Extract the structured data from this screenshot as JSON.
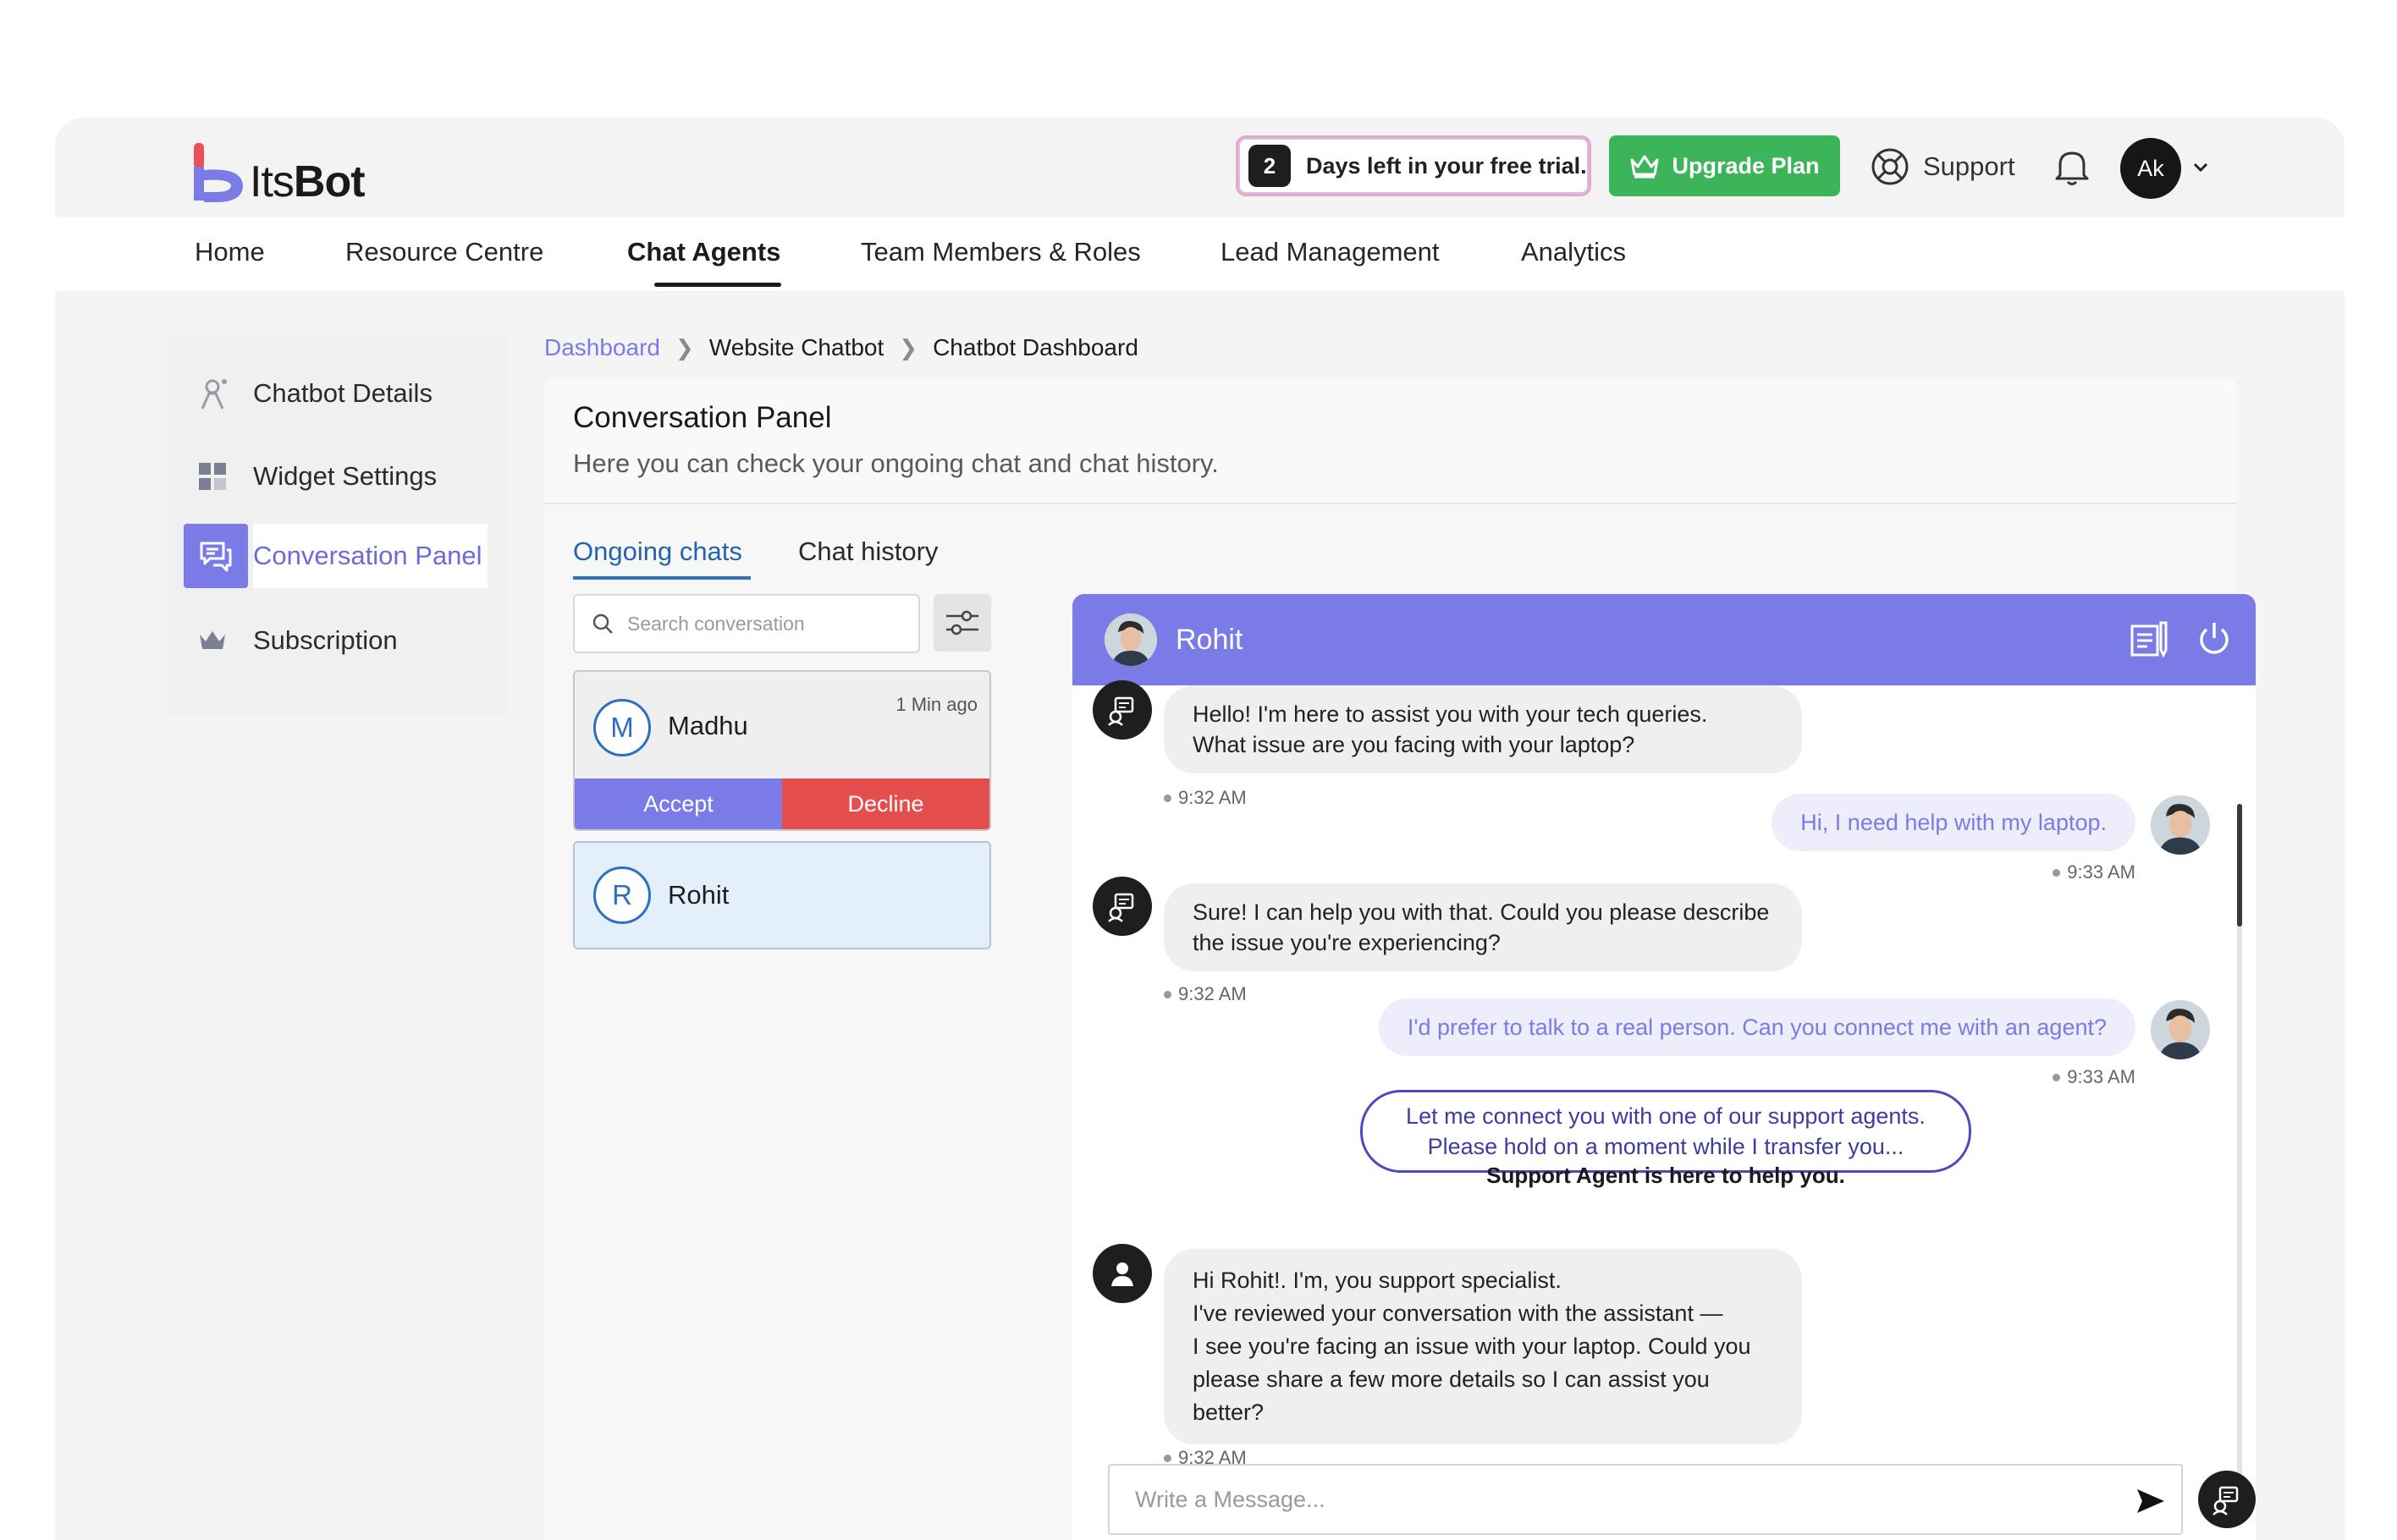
{
  "brand": {
    "logo_text_light": "Its",
    "logo_text_bold": "Bot",
    "accent": "#7b7be7"
  },
  "header": {
    "trial_days": "2",
    "trial_text": "Days left in your free trial.",
    "upgrade_label": "Upgrade Plan",
    "support_label": "Support",
    "avatar_initials": "Ak"
  },
  "nav": {
    "items": [
      {
        "label": "Home"
      },
      {
        "label": "Resource Centre"
      },
      {
        "label": "Chat Agents"
      },
      {
        "label": "Team Members & Roles"
      },
      {
        "label": "Lead Management"
      },
      {
        "label": "Analytics"
      }
    ],
    "active": "Chat Agents"
  },
  "sidebar": {
    "items": [
      {
        "label": "Chatbot Details",
        "icon": "chatbot-icon"
      },
      {
        "label": "Widget Settings",
        "icon": "widget-icon"
      },
      {
        "label": "Conversation Panel",
        "icon": "conversation-icon"
      },
      {
        "label": "Subscription",
        "icon": "crown-icon"
      }
    ],
    "active": "Conversation Panel"
  },
  "breadcrumb": {
    "items": [
      "Dashboard",
      "Website Chatbot",
      "Chatbot Dashboard"
    ]
  },
  "panel": {
    "title": "Conversation Panel",
    "subtitle": "Here you can check your ongoing chat and chat history."
  },
  "tabs": {
    "ongoing": "Ongoing chats",
    "history": "Chat history"
  },
  "search": {
    "placeholder": "Search conversation"
  },
  "conversations": [
    {
      "initial": "M",
      "name": "Madhu",
      "time": "1 Min ago",
      "accept": "Accept",
      "decline": "Decline"
    },
    {
      "initial": "R",
      "name": "Rohit"
    }
  ],
  "chat": {
    "contact_name": "Rohit",
    "messages": [
      {
        "from": "bot",
        "lines": [
          "Hello! I'm here to assist you with your tech queries.",
          "What issue are you facing with your laptop?"
        ],
        "time": "9:32 AM"
      },
      {
        "from": "user",
        "lines": [
          "Hi, I need help with my laptop."
        ],
        "time": "9:33 AM"
      },
      {
        "from": "bot",
        "lines": [
          "Sure! I can help you with that. Could you please describe",
          "the issue you're experiencing?"
        ],
        "time": "9:32 AM"
      },
      {
        "from": "user",
        "lines": [
          "I'd prefer to talk to a real person. Can you connect me with an agent?"
        ],
        "time": "9:33 AM"
      },
      {
        "from": "system",
        "lines": [
          "Let me connect you with one of our support agents.",
          "Please hold on a moment while I transfer you..."
        ]
      },
      {
        "from": "note",
        "text": "Support Agent is here to help you."
      },
      {
        "from": "agent",
        "lines": [
          "Hi Rohit!. I'm, you support specialist.",
          " I've reviewed your conversation with the assistant —",
          "I see you're facing an issue with your laptop. Could you",
          "please share a few more details so I can assist you",
          "better?"
        ],
        "time": "9:32 AM"
      }
    ],
    "composer_placeholder": "Write a Message..."
  }
}
